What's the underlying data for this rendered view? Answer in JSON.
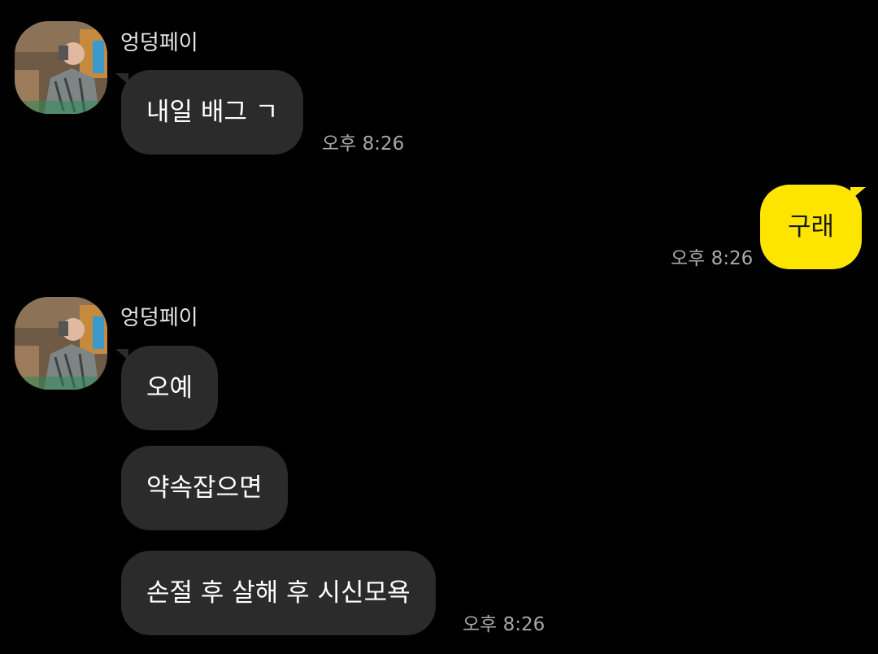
{
  "chat": {
    "groups": [
      {
        "sender": "엉덩페이",
        "messages": [
          "내일 배그 ㄱ"
        ],
        "time": "오후 8:26"
      },
      {
        "sender": "me",
        "messages": [
          "구래"
        ],
        "time": "오후 8:26"
      },
      {
        "sender": "엉덩페이",
        "messages": [
          "오예",
          "약속잡으면",
          "손절 후 살해 후 시신모욕"
        ],
        "time": "오후 8:26"
      }
    ]
  },
  "colors": {
    "background": "#000000",
    "incoming_bubble": "#2b2b2b",
    "outgoing_bubble": "#fee500",
    "timestamp": "#a8a8a8"
  },
  "icons": {
    "avatar": "profile-photo"
  }
}
